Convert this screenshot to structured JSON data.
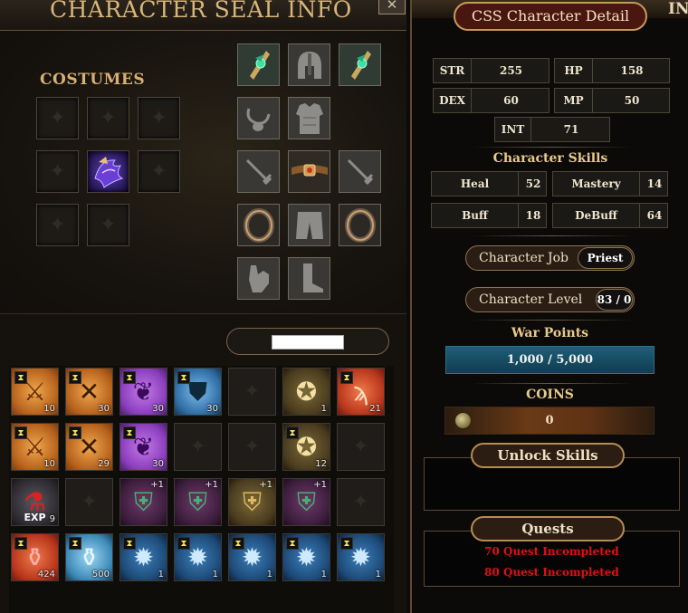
{
  "left_panel": {
    "title": "CHARACTER SEAL INFO",
    "close_glyph": "✕",
    "costumes_label": "COSTUMES"
  },
  "equipment_icons": {
    "earring_left": "ear-gem-icon",
    "helmet": "helmet-icon",
    "earring_right": "ear-gem-icon",
    "necklace": "necklace-icon",
    "armor": "chest-armor-icon",
    "weapon_left": "sword-icon",
    "belt": "belt-icon",
    "weapon_right": "sword-icon",
    "ring_left": "ring-icon",
    "pants": "pants-icon",
    "ring_right": "ring-icon",
    "gloves": "glove-icon",
    "boots": "boot-icon"
  },
  "inventory": {
    "rows": [
      [
        {
          "icon": "scroll-orange-icon",
          "count": "10",
          "timed": true,
          "bg": "orange"
        },
        {
          "icon": "scroll-crossed-swords-icon",
          "count": "30",
          "timed": true,
          "bg": "orange"
        },
        {
          "icon": "scroll-purple-icon",
          "count": "30",
          "timed": true,
          "bg": "purple"
        },
        {
          "icon": "shield-scroll-icon",
          "count": "30",
          "timed": true,
          "bg": "blue"
        },
        {
          "icon": "empty-slot",
          "count": "",
          "timed": false,
          "bg": "dark"
        },
        {
          "icon": "card-scroll-icon",
          "count": "1",
          "timed": false,
          "bg": "gold"
        },
        {
          "icon": "red-rune-scroll-icon",
          "count": "21",
          "timed": true,
          "bg": "red"
        }
      ],
      [
        {
          "icon": "scroll-orange-icon",
          "count": "10",
          "timed": true,
          "bg": "orange"
        },
        {
          "icon": "scroll-crossed-swords-icon",
          "count": "29",
          "timed": true,
          "bg": "orange"
        },
        {
          "icon": "scroll-purple-icon",
          "count": "30",
          "timed": true,
          "bg": "purple"
        },
        {
          "icon": "empty-slot",
          "count": "",
          "timed": false,
          "bg": "dark"
        },
        {
          "icon": "empty-slot",
          "count": "",
          "timed": false,
          "bg": "dark"
        },
        {
          "icon": "card-scroll-icon",
          "count": "12",
          "timed": true,
          "bg": "gold"
        },
        {
          "icon": "empty-slot",
          "count": "",
          "timed": false,
          "bg": "dark"
        }
      ],
      [
        {
          "icon": "exp-potion-icon",
          "count": "9",
          "timed": false,
          "bg": "grey",
          "label": "EXP"
        },
        {
          "icon": "empty-slot",
          "count": "",
          "timed": false,
          "bg": "dark"
        },
        {
          "icon": "green-armor-icon",
          "count": "",
          "plus": "+1",
          "timed": false,
          "bg": "magenta"
        },
        {
          "icon": "green-armor-icon",
          "count": "",
          "plus": "+1",
          "timed": false,
          "bg": "magenta"
        },
        {
          "icon": "gold-armor-icon",
          "count": "",
          "plus": "+1",
          "timed": false,
          "bg": "gold"
        },
        {
          "icon": "green-armor-icon",
          "count": "",
          "plus": "+1",
          "timed": false,
          "bg": "magenta"
        },
        {
          "icon": "empty-slot",
          "count": "",
          "timed": false,
          "bg": "dark"
        }
      ],
      [
        {
          "icon": "red-potions-icon",
          "count": "424",
          "timed": true,
          "bg": "red"
        },
        {
          "icon": "blue-potions-icon",
          "count": "500",
          "timed": true,
          "bg": "sky"
        },
        {
          "icon": "blue-gem-icon",
          "count": "1",
          "timed": true,
          "bg": "deep"
        },
        {
          "icon": "blue-gem-icon",
          "count": "1",
          "timed": true,
          "bg": "deep"
        },
        {
          "icon": "blue-gem-icon",
          "count": "1",
          "timed": true,
          "bg": "deep"
        },
        {
          "icon": "blue-gem-icon",
          "count": "1",
          "timed": true,
          "bg": "deep"
        },
        {
          "icon": "blue-gem-icon",
          "count": "1",
          "timed": true,
          "bg": "deep"
        }
      ]
    ]
  },
  "right_panel": {
    "title": "CSS Character Detail",
    "corner_text": "IN",
    "stats": {
      "str_label": "STR",
      "str_value": "255",
      "hp_label": "HP",
      "hp_value": "158",
      "dex_label": "DEX",
      "dex_value": "60",
      "mp_label": "MP",
      "mp_value": "50",
      "int_label": "INT",
      "int_value": "71"
    },
    "skills_title": "Character Skills",
    "skills": {
      "heal_label": "Heal",
      "heal_value": "52",
      "mastery_label": "Mastery",
      "mastery_value": "14",
      "buff_label": "Buff",
      "buff_value": "18",
      "debuff_label": "DeBuff",
      "debuff_value": "64"
    },
    "job_label": "Character Job",
    "job_value": "Priest",
    "level_label": "Character Level",
    "level_value": "83 / 0",
    "war_points_title": "War Points",
    "war_points_value": "1,000 / 5,000",
    "coins_title": "COINS",
    "coins_value": "0",
    "unlock_skills_label": "Unlock Skills",
    "quests_label": "Quests",
    "quests": [
      "70 Quest Incompleted",
      "80 Quest Incompleted"
    ]
  },
  "colors": {
    "accent_gold": "#d9b67a",
    "quest_red": "#e01010",
    "war_bar": "#1d5f78"
  }
}
